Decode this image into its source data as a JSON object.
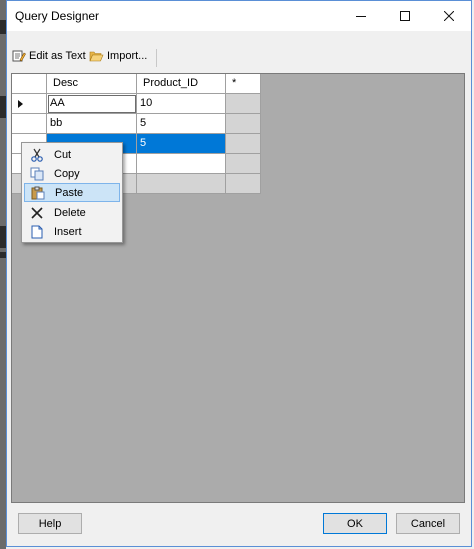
{
  "window": {
    "title": "Query Designer"
  },
  "toolbar": {
    "edit_as_text": "Edit as Text",
    "import": "Import..."
  },
  "grid": {
    "columns": [
      "Desc",
      "Product_ID",
      "*"
    ],
    "rows": [
      {
        "desc": "AA",
        "product_id": "10"
      },
      {
        "desc": "bb",
        "product_id": "5"
      },
      {
        "desc": "",
        "product_id": "5"
      }
    ]
  },
  "context_menu": {
    "items": [
      "Cut",
      "Copy",
      "Paste",
      "Delete",
      "Insert"
    ]
  },
  "buttons": {
    "help": "Help",
    "ok": "OK",
    "cancel": "Cancel"
  },
  "icons": {
    "edit_as_text": "edit-text-icon",
    "import": "folder-open-icon",
    "cut": "scissors-icon",
    "copy": "copy-icon",
    "paste": "paste-icon",
    "delete": "x-icon",
    "insert": "document-icon",
    "row_indicator": "current-row-triangle-icon"
  },
  "colors": {
    "selection": "#0078d7",
    "menu_highlight": "#cce4f7",
    "grid_background": "#ababab"
  }
}
